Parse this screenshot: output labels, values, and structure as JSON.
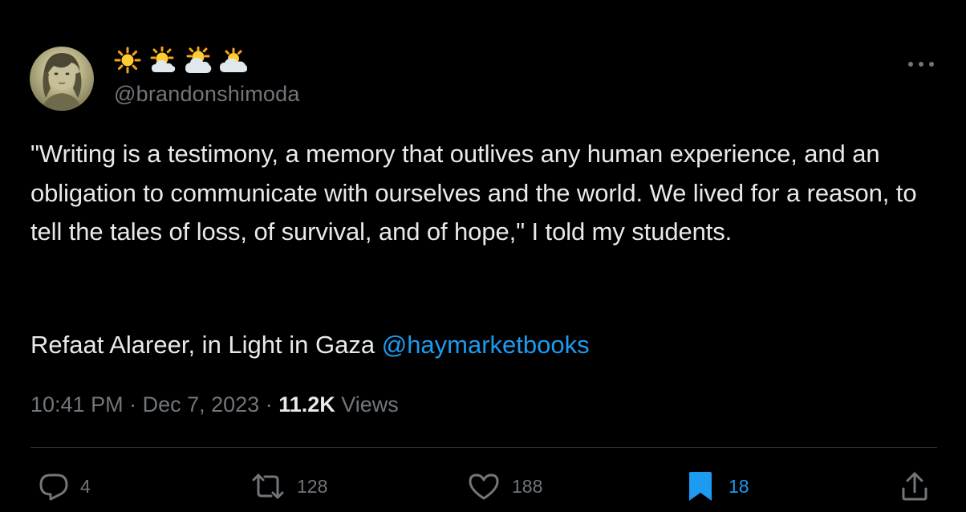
{
  "author": {
    "display_name_icons": [
      "sun-icon",
      "sun-behind-small-cloud-icon",
      "sun-behind-cloud-icon",
      "sun-behind-large-cloud-icon"
    ],
    "handle": "@brandonshimoda"
  },
  "tweet": {
    "quote_text": "\"Writing is a testimony, a memory that outlives any human experience, and an obligation to communicate with ourselves and the world. We lived for a reason, to tell the tales of loss, of survival, and of hope,\" I told my students.",
    "attribution_text": "Refaat Alareer, in Light in Gaza ",
    "mention": "@haymarketbooks"
  },
  "meta": {
    "time": "10:41 PM",
    "separator1": " · ",
    "date": "Dec 7, 2023",
    "separator2": " · ",
    "views_count": "11.2K",
    "views_label": " Views"
  },
  "actions": {
    "replies": "4",
    "reposts": "128",
    "likes": "188",
    "bookmarks": "18"
  },
  "colors": {
    "background": "#000000",
    "text_primary": "#e7e9ea",
    "text_secondary": "#71767b",
    "accent": "#1d9bf0",
    "divider": "#2f3336"
  }
}
